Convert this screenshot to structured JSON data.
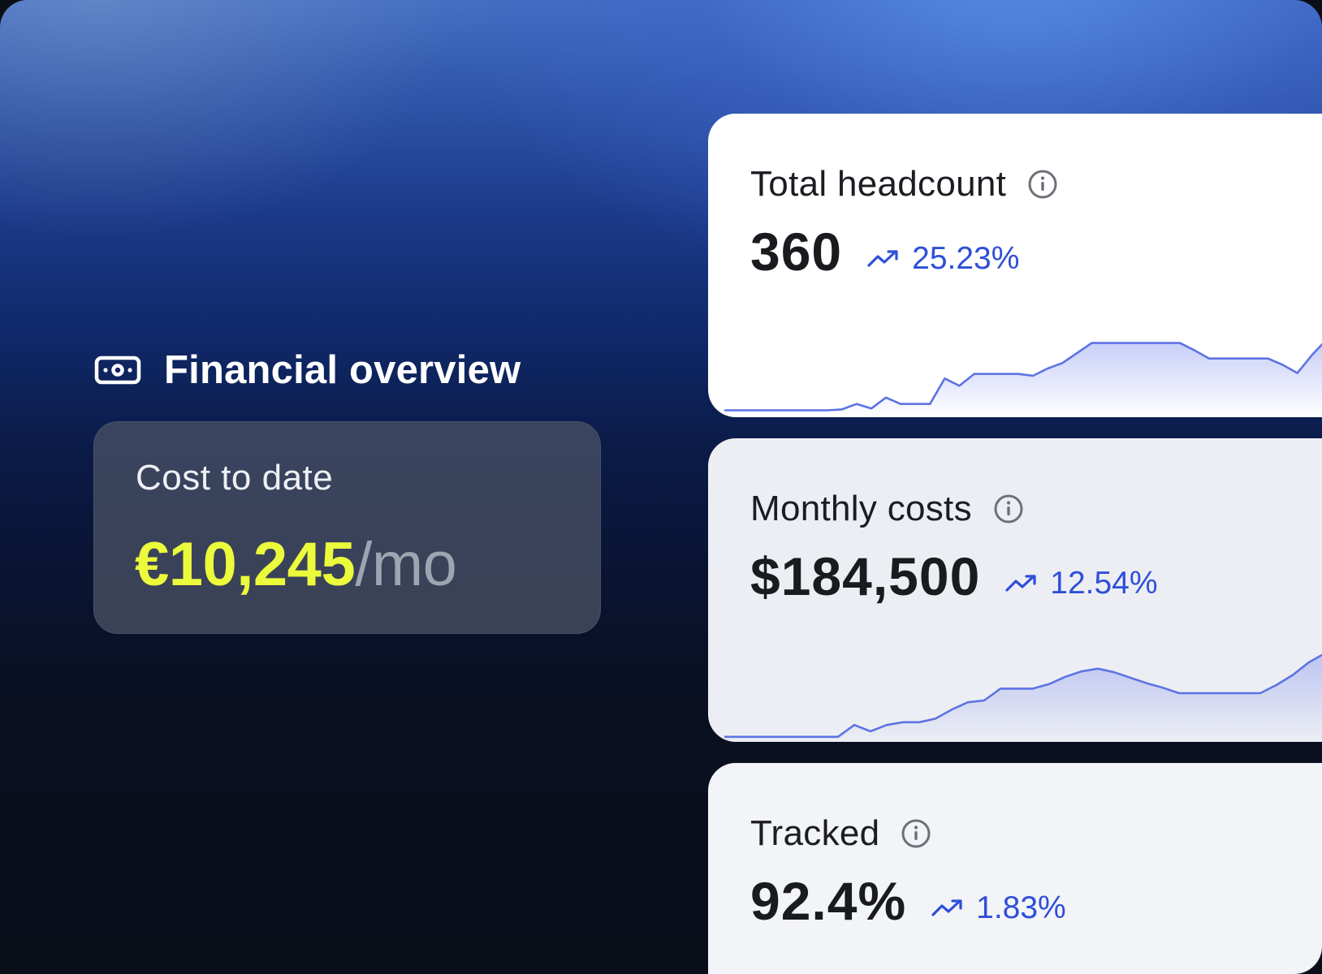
{
  "financial_overview": {
    "title": "Financial overview",
    "icon": "cash-icon",
    "cost_card": {
      "label": "Cost to date",
      "value": "€10,245",
      "unit": "/mo",
      "value_color": "#ecfa3c"
    }
  },
  "stats": [
    {
      "label": "Total headcount",
      "value": "360",
      "trend": "25.23%",
      "trend_direction": "up",
      "sparkline": [
        4,
        4,
        4,
        4,
        4,
        4,
        4,
        4,
        5,
        11,
        6,
        18,
        11,
        11,
        11,
        39,
        31,
        44,
        44,
        44,
        44,
        42,
        50,
        56,
        67,
        78,
        78,
        78,
        78,
        78,
        78,
        78,
        70,
        61,
        61,
        61,
        61,
        61,
        54,
        45,
        65,
        82,
        82
      ]
    },
    {
      "label": "Monthly costs",
      "value": "$184,500",
      "trend": "12.54%",
      "trend_direction": "up",
      "sparkline": [
        2,
        2,
        2,
        2,
        2,
        2,
        2,
        2,
        15,
        8,
        15,
        18,
        18,
        22,
        32,
        40,
        42,
        55,
        55,
        55,
        60,
        68,
        74,
        77,
        73,
        67,
        61,
        56,
        50,
        50,
        50,
        50,
        50,
        50,
        59,
        70,
        84,
        94,
        96
      ]
    },
    {
      "label": "Tracked",
      "value": "92.4%",
      "trend": "1.83%",
      "trend_direction": "up"
    }
  ],
  "colors": {
    "trend": "#2f4fd8",
    "spark_line": "#5d73e3",
    "spark_fill": "#7f8ff0"
  }
}
